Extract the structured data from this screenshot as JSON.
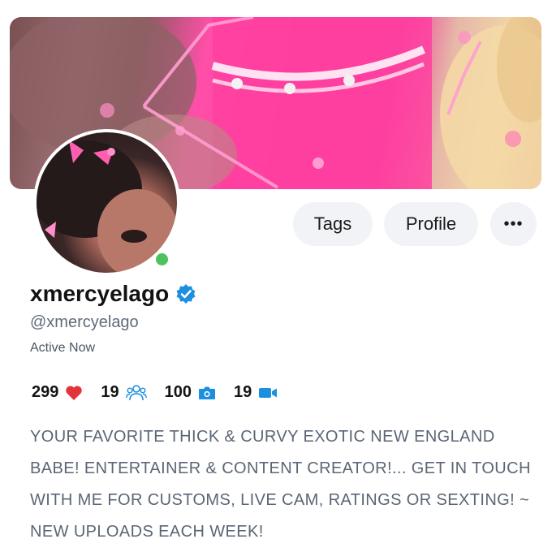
{
  "profile": {
    "name": "xmercyelago",
    "handle": "@xmercyelago",
    "status": "Active Now",
    "bio": "YOUR FAVORITE THICK & CURVY EXOTIC NEW ENGLAND BABE! ENTERTAINER & CONTENT CREATOR!... GET IN TOUCH WITH ME FOR CUSTOMS, LIVE CAM, RATINGS OR SEXTING! ~ NEW UPLOADS EACH WEEK!"
  },
  "actions": {
    "tags_label": "Tags",
    "profile_label": "Profile",
    "more_label": "•••"
  },
  "stats": {
    "likes": "299",
    "subscribers": "19",
    "photos": "100",
    "videos": "19"
  },
  "icons": {
    "likes": "heart-icon",
    "subscribers": "users-icon",
    "photos": "camera-icon",
    "videos": "video-icon",
    "verified": "verified-check-icon"
  },
  "colors": {
    "accent_blue": "#1d8fe1",
    "heart_red": "#e4343b",
    "online_green": "#4cc35e",
    "button_bg": "#f1f3f6",
    "bio_text": "#5b6675"
  }
}
